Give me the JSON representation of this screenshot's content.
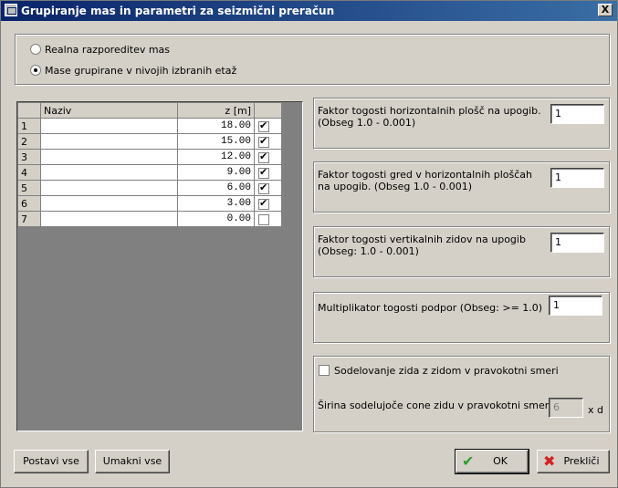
{
  "window": {
    "title": "Grupiranje mas in parametri za seizmični preračun",
    "close_label": "X"
  },
  "mass_mode": {
    "options": [
      {
        "label": "Realna razporeditev mas",
        "selected": false
      },
      {
        "label": "Mase grupirane v nivojih izbranih etaž",
        "selected": true
      }
    ]
  },
  "grid": {
    "headers": {
      "name": "Naziv",
      "z": "z [m]"
    },
    "rows": [
      {
        "num": "1",
        "name": "",
        "z": "18.00",
        "checked": true
      },
      {
        "num": "2",
        "name": "",
        "z": "15.00",
        "checked": true
      },
      {
        "num": "3",
        "name": "",
        "z": "12.00",
        "checked": true
      },
      {
        "num": "4",
        "name": "",
        "z": "9.00",
        "checked": true
      },
      {
        "num": "5",
        "name": "",
        "z": "6.00",
        "checked": true
      },
      {
        "num": "6",
        "name": "",
        "z": "3.00",
        "checked": true
      },
      {
        "num": "7",
        "name": "",
        "z": "0.00",
        "checked": false
      }
    ]
  },
  "params": {
    "slab": {
      "label": "Faktor togosti horizontalnih plošč na upogib.(Obseg 1.0 - 0.001)",
      "value": "1"
    },
    "beam": {
      "label": "Faktor togosti gred v horizontalnih ploščah na upogib. (Obseg 1.0 - 0.001)",
      "value": "1"
    },
    "wall": {
      "label": "Faktor togosti vertikalnih zidov na upogib (Obseg: 1.0 - 0.001)",
      "value": "1"
    },
    "support": {
      "label": "Multiplikator togosti podpor (Obseg: >= 1.0)",
      "value": "1"
    }
  },
  "cooperation": {
    "checkbox_label": "Sodelovanje zida z zidom v pravokotni smeri",
    "checked": false,
    "width_label": "Širina sodelujoče cone zidu v pravokotni smeri",
    "width_value": "6",
    "unit": "x d"
  },
  "buttons": {
    "set_all": "Postavi vse",
    "clear_all": "Umakni vse",
    "ok": "OK",
    "cancel": "Prekliči"
  }
}
